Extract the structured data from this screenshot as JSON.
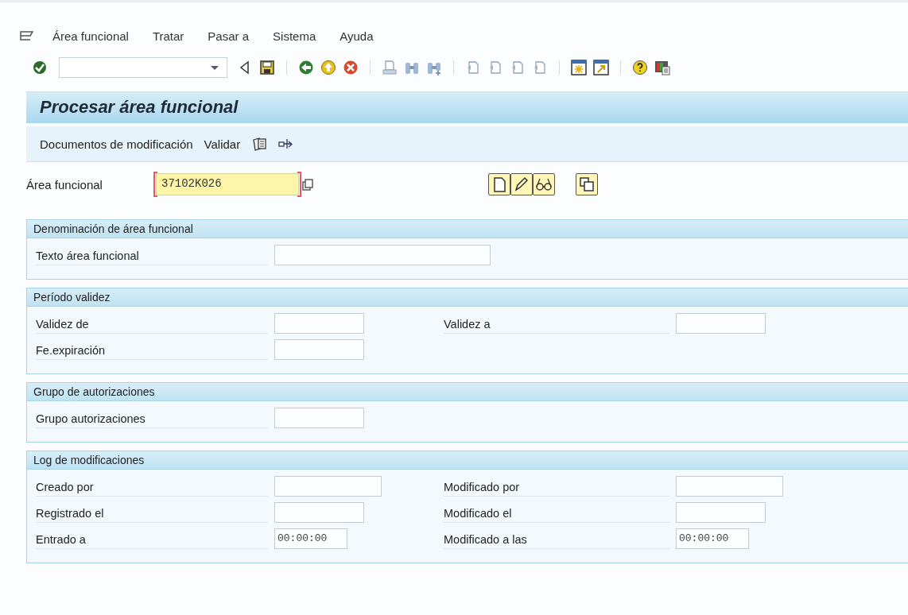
{
  "menu": [
    {
      "label": "Área funcional"
    },
    {
      "label": "Tratar"
    },
    {
      "label": "Pasar a"
    },
    {
      "label": "Sistema"
    },
    {
      "label": "Ayuda"
    }
  ],
  "title": "Procesar área funcional",
  "app_toolbar": [
    {
      "label": "Documentos de modificación"
    },
    {
      "label": "Validar"
    }
  ],
  "key_field": {
    "label": "Área funcional",
    "value": "37102K026",
    "required": true
  },
  "groups": [
    {
      "title": "Denominación de área funcional",
      "rows": [
        [
          {
            "label": "Texto área funcional",
            "kind": "text"
          }
        ]
      ]
    },
    {
      "title": "Período validez",
      "rows": [
        [
          {
            "label": "Validez de",
            "kind": "date"
          },
          {
            "label": "Validez a",
            "kind": "date"
          }
        ],
        [
          {
            "label": "Fe.expiración",
            "kind": "date"
          }
        ]
      ]
    },
    {
      "title": "Grupo de autorizaciones",
      "rows": [
        [
          {
            "label": "Grupo autorizaciones",
            "kind": "date"
          }
        ]
      ]
    },
    {
      "title": "Log de modificaciones",
      "rows": [
        [
          {
            "label": "Creado por",
            "kind": "user"
          },
          {
            "label": "Modificado por",
            "kind": "user"
          }
        ],
        [
          {
            "label": "Registrado el",
            "kind": "date"
          },
          {
            "label": "Modificado el",
            "kind": "date"
          }
        ],
        [
          {
            "label": "Entrado a",
            "kind": "time",
            "value": "00:00:00"
          },
          {
            "label": "Modificado a las",
            "kind": "time",
            "value": "00:00:00"
          }
        ]
      ]
    }
  ]
}
